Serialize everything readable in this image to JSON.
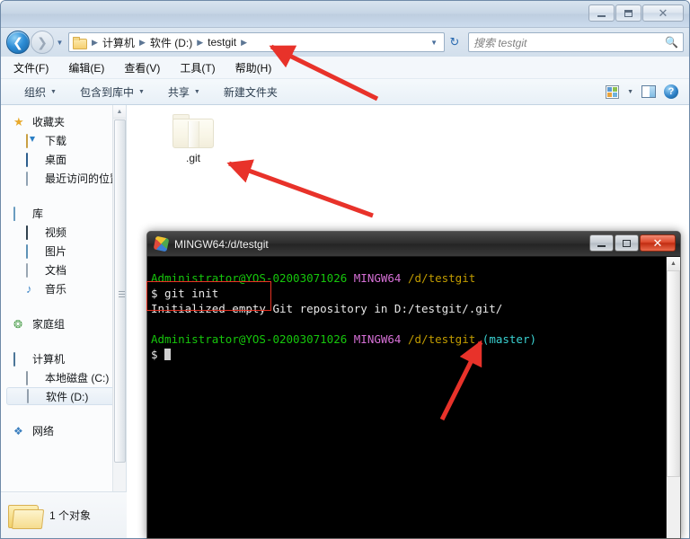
{
  "explorer": {
    "window_controls": [
      {
        "name": "minimize",
        "glyph": "–"
      },
      {
        "name": "maximize",
        "glyph": "□"
      },
      {
        "name": "close",
        "glyph": "✕"
      }
    ],
    "address": {
      "breadcrumbs": [
        "计算机",
        "软件 (D:)",
        "testgit"
      ],
      "separator": "▶",
      "dropdown_glyph": "▼",
      "refresh_glyph": "↻"
    },
    "search": {
      "placeholder": "搜索 testgit",
      "value": "",
      "icon": "search-icon"
    },
    "menubar": [
      "文件(F)",
      "编辑(E)",
      "查看(V)",
      "工具(T)",
      "帮助(H)"
    ],
    "toolbar": {
      "items": [
        {
          "label": "组织",
          "has_caret": true
        },
        {
          "label": "包含到库中",
          "has_caret": true
        },
        {
          "label": "共享",
          "has_caret": true
        },
        {
          "label": "新建文件夹",
          "has_caret": false
        }
      ],
      "caret_glyph": "▼",
      "right_icons": [
        "change-view-icon",
        "view-dropdown-caret",
        "preview-pane-icon",
        "help-icon"
      ],
      "help_glyph": "?"
    },
    "sidebar": {
      "groups": [
        {
          "header": {
            "label": "收藏夹",
            "icon": "favorites-star-icon"
          },
          "items": [
            {
              "label": "下载",
              "icon": "downloads-icon"
            },
            {
              "label": "桌面",
              "icon": "desktop-icon"
            },
            {
              "label": "最近访问的位置",
              "icon": "recent-places-icon"
            }
          ]
        },
        {
          "header": {
            "label": "库",
            "icon": "library-icon"
          },
          "items": [
            {
              "label": "视频",
              "icon": "videos-icon"
            },
            {
              "label": "图片",
              "icon": "pictures-icon"
            },
            {
              "label": "文档",
              "icon": "documents-icon"
            },
            {
              "label": "音乐",
              "icon": "music-icon"
            }
          ]
        },
        {
          "header": {
            "label": "家庭组",
            "icon": "homegroup-icon"
          },
          "items": []
        },
        {
          "header": {
            "label": "计算机",
            "icon": "computer-icon"
          },
          "items": [
            {
              "label": "本地磁盘 (C:)",
              "icon": "local-disk-icon",
              "selected": false
            },
            {
              "label": "软件 (D:)",
              "icon": "drive-icon",
              "selected": true
            }
          ]
        },
        {
          "header": {
            "label": "网络",
            "icon": "network-icon"
          },
          "items": []
        }
      ],
      "scroll_up_glyph": "▲",
      "scroll_down_glyph": "▼"
    },
    "files": [
      {
        "name": ".git",
        "type": "folder",
        "hidden": true
      }
    ],
    "status": {
      "text": "1 个对象",
      "icon": "folder-icon"
    }
  },
  "terminal": {
    "title": "MINGW64:/d/testgit",
    "logo": "git-bash-logo-icon",
    "window_controls": [
      {
        "name": "minimize",
        "glyph": "–"
      },
      {
        "name": "maximize",
        "glyph": "□"
      },
      {
        "name": "close",
        "glyph": "✕"
      }
    ],
    "colors": {
      "user_host": "#16c60c",
      "shell_name": "#d670d6",
      "path": "#c19c00",
      "branch": "#3ad1d1",
      "text": "#e8e8e8",
      "background": "#000000"
    },
    "lines": [
      {
        "type": "prompt",
        "user_host": "Administrator@YOS-02003071026",
        "shell": "MINGW64",
        "path": "/d/testgit",
        "branch": ""
      },
      {
        "type": "command",
        "text": "$ git init"
      },
      {
        "type": "output",
        "text": "Initialized empty Git repository in D:/testgit/.git/"
      },
      {
        "type": "blank",
        "text": ""
      },
      {
        "type": "prompt",
        "user_host": "Administrator@YOS-02003071026",
        "shell": "MINGW64",
        "path": "/d/testgit",
        "branch": "(master)"
      },
      {
        "type": "command",
        "text": "$ "
      }
    ],
    "scroll_up_glyph": "▲"
  },
  "annotations": {
    "highlight_color": "#e83323",
    "arrow_color": "#e8322a",
    "arrows": [
      {
        "name": "arrow-to-breadcrumb-testgit",
        "target": "testgit breadcrumb"
      },
      {
        "name": "arrow-to-git-folder",
        "target": ".git folder"
      },
      {
        "name": "arrow-to-master-branch",
        "target": "(master) branch label"
      }
    ],
    "boxes": [
      {
        "name": "git-init-highlight-box",
        "target": "$ git init / Initialized empty Git repository"
      }
    ]
  }
}
